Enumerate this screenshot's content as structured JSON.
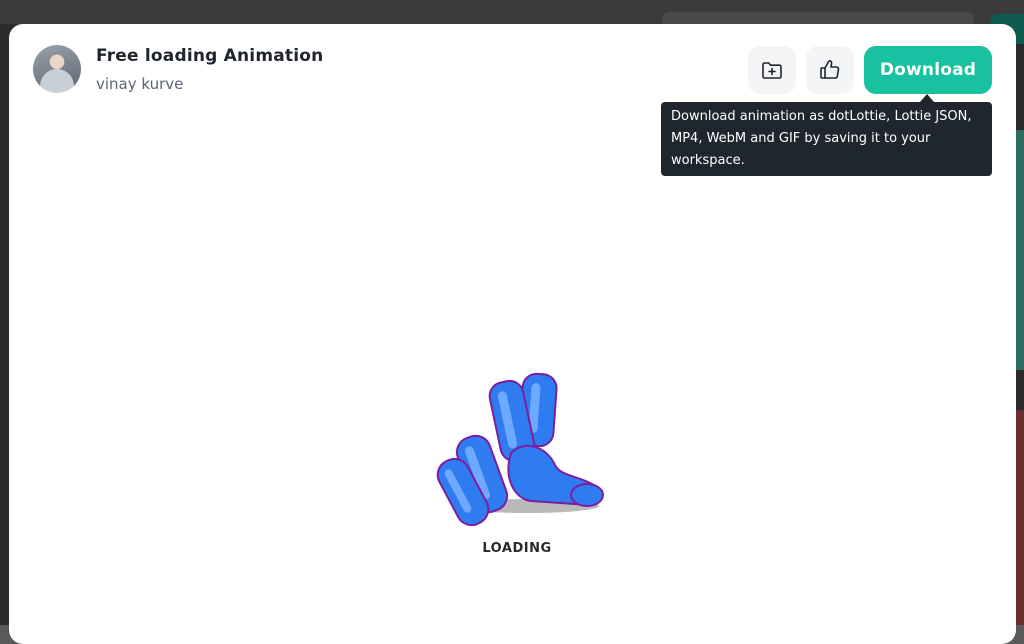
{
  "animation": {
    "title": "Free loading Animation",
    "author": "vinay kurve",
    "loading_label": "LOADING"
  },
  "actions": {
    "save_icon": "folder-plus-icon",
    "like_icon": "thumbs-up-icon",
    "download_label": "Download"
  },
  "tooltip": {
    "text": "Download animation as dotLottie, Lottie JSON, MP4, WebM and GIF by saving it to your workspace."
  },
  "colors": {
    "accent": "#18c2a0",
    "highlight_border": "#e0242b",
    "tooltip_bg": "#20262e",
    "hand_fill": "#2f7bf0",
    "hand_outline": "#7a1fa0"
  }
}
